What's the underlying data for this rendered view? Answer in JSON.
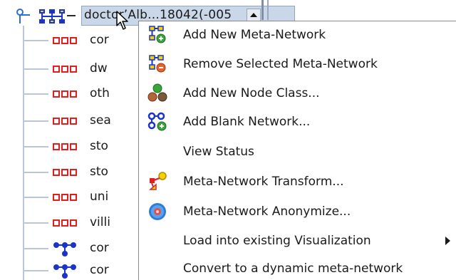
{
  "tree": {
    "root": {
      "label": "doctor’Alb...18042(-005"
    },
    "rows": [
      {
        "kind": "nodeclass",
        "label": "cor"
      },
      {
        "kind": "nodeclass",
        "label": "dw"
      },
      {
        "kind": "nodeclass",
        "label": "oth"
      },
      {
        "kind": "nodeclass",
        "label": "sea"
      },
      {
        "kind": "nodeclass",
        "label": "sto"
      },
      {
        "kind": "nodeclass",
        "label": "sto"
      },
      {
        "kind": "nodeclass",
        "label": "uni"
      },
      {
        "kind": "nodeclass",
        "label": "villi"
      },
      {
        "kind": "network",
        "label": "cor"
      },
      {
        "kind": "network",
        "label": "cor"
      }
    ]
  },
  "context_menu": {
    "items": [
      {
        "label": "Add New Meta-Network",
        "icon": "add-meta-network-icon"
      },
      {
        "label": "Remove Selected Meta-Network",
        "icon": "remove-meta-network-icon"
      },
      {
        "label": "Add New Node Class...",
        "icon": "add-node-class-icon"
      },
      {
        "label": "Add Blank Network...",
        "icon": "add-blank-network-icon"
      },
      {
        "label": "View Status",
        "icon": ""
      },
      {
        "label": "Meta-Network Transform...",
        "icon": "transform-icon"
      },
      {
        "label": "Meta-Network Anonymize...",
        "icon": "anonymize-icon"
      },
      {
        "label": "Load into existing Visualization",
        "icon": "",
        "submenu": true
      },
      {
        "label": "Convert to a dynamic meta-network",
        "icon": ""
      }
    ]
  },
  "colors": {
    "selection_bg": "#c9d7e8",
    "node_class_red": "#e02020",
    "network_blue": "#1a33c8",
    "accent_yellow": "#f2d200",
    "accent_green": "#3aa63a"
  }
}
